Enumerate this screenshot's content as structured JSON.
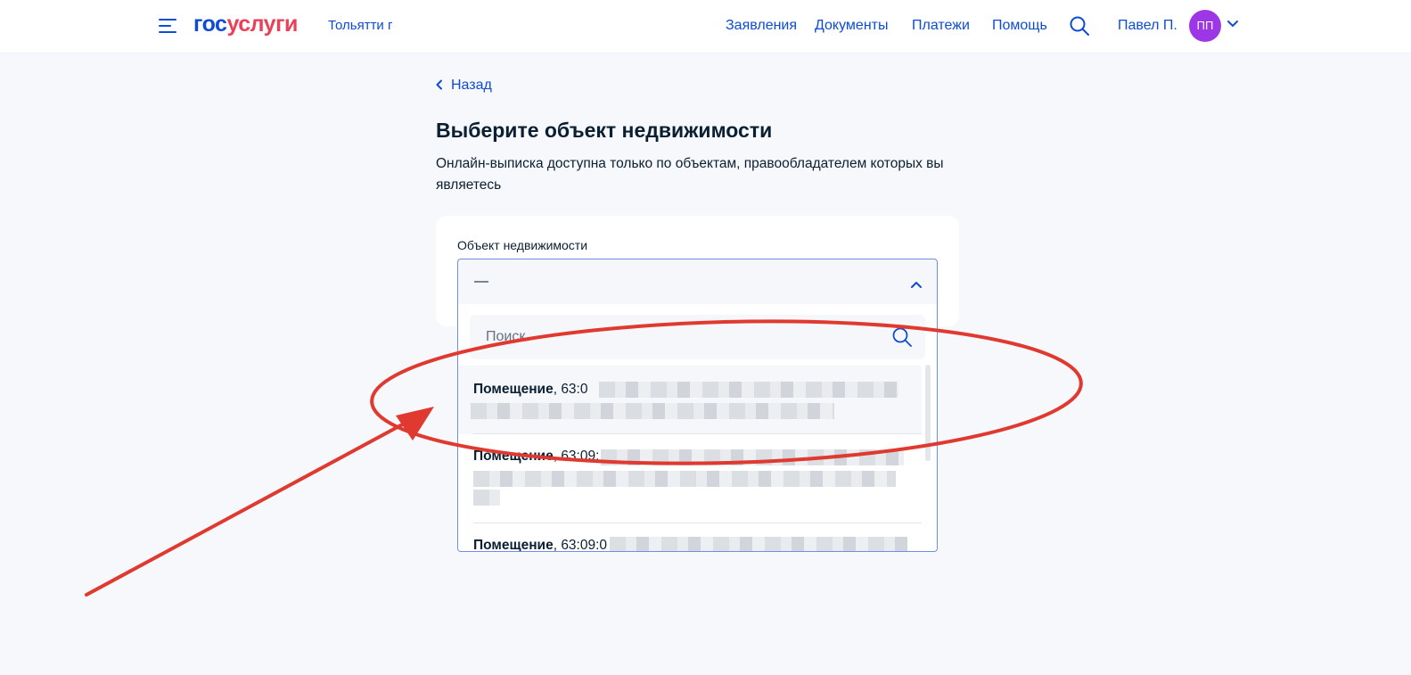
{
  "header": {
    "logo_part1": "гос",
    "logo_part2": "услуги",
    "city": "Тольятти г",
    "nav": [
      {
        "label": "Заявления"
      },
      {
        "label": "Документы"
      },
      {
        "label": "Платежи"
      },
      {
        "label": "Помощь"
      }
    ],
    "user_name": "Павел П.",
    "avatar_initials": "ПП",
    "menu_icon": "burger-menu-icon",
    "search_icon": "search-icon",
    "user_chevron_icon": "chevron-down-icon"
  },
  "back": {
    "label": "Назад",
    "icon": "chevron-left-icon"
  },
  "page": {
    "title": "Выберите объект недвижимости",
    "subtitle_line1": "Онлайн-выписка доступна только по объектам, правообладателем которых вы",
    "subtitle_line2": "являетесь"
  },
  "form": {
    "field_label": "Объект недвижимости",
    "selected_value": "—",
    "chevron_icon": "chevron-up-icon",
    "search_placeholder": "Поиск",
    "options": [
      {
        "type": "Помещение",
        "number_prefix": ", 63:0"
      },
      {
        "type": "Помещение",
        "number_prefix": ", 63:09:"
      },
      {
        "type": "Помещение",
        "number_prefix": ", 63:09:0"
      }
    ]
  },
  "colors": {
    "brand_blue": "#0d4cd3",
    "brand_red": "#ee3f58",
    "avatar_bg": "#9d37e6",
    "annotation_red": "#e0392f",
    "page_bg": "#f6f8fb"
  }
}
